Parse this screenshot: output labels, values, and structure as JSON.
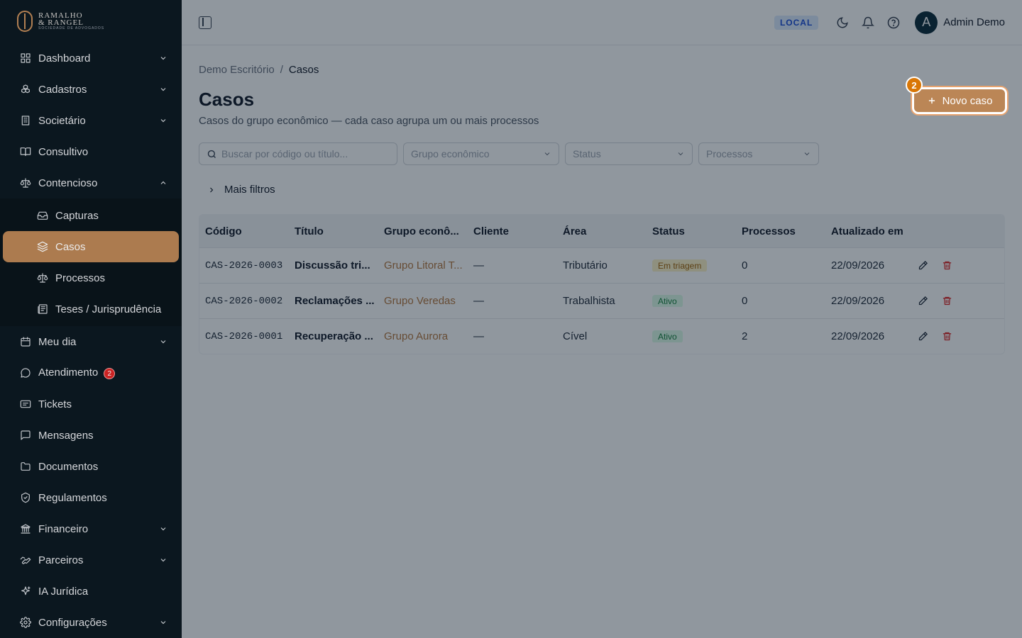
{
  "brand": {
    "line1": "RAMALHO",
    "line2": "& RANGEL",
    "tagline": "SOCIEDADE DE ADVOGADOS"
  },
  "sidebar": {
    "items": [
      {
        "label": "Dashboard",
        "icon": "grid-icon",
        "expandable": true
      },
      {
        "label": "Cadastros",
        "icon": "boxes-icon",
        "expandable": true
      },
      {
        "label": "Societário",
        "icon": "building-icon",
        "expandable": true
      },
      {
        "label": "Consultivo",
        "icon": "book-icon",
        "expandable": false
      },
      {
        "label": "Contencioso",
        "icon": "scale-icon",
        "expandable": true,
        "expanded": true
      }
    ],
    "subitems": [
      {
        "label": "Capturas",
        "icon": "inbox-icon"
      },
      {
        "label": "Casos",
        "icon": "layers-icon",
        "active": true
      },
      {
        "label": "Processos",
        "icon": "scale-icon"
      },
      {
        "label": "Teses / Jurisprudência",
        "icon": "newspaper-icon"
      }
    ],
    "items_after": [
      {
        "label": "Meu dia",
        "icon": "calendar-icon",
        "expandable": true
      },
      {
        "label": "Atendimento",
        "icon": "chat-icon",
        "badge": "2"
      },
      {
        "label": "Tickets",
        "icon": "ticket-icon"
      },
      {
        "label": "Mensagens",
        "icon": "message-icon"
      },
      {
        "label": "Documentos",
        "icon": "folder-icon"
      },
      {
        "label": "Regulamentos",
        "icon": "shield-icon"
      },
      {
        "label": "Financeiro",
        "icon": "landmark-icon",
        "expandable": true
      },
      {
        "label": "Parceiros",
        "icon": "handshake-icon",
        "expandable": true
      },
      {
        "label": "IA Jurídica",
        "icon": "sparkles-icon"
      },
      {
        "label": "Configurações",
        "icon": "gear-icon",
        "expandable": true
      }
    ]
  },
  "header": {
    "env": "LOCAL",
    "avatar_initial": "A",
    "user_name": "Admin Demo"
  },
  "page": {
    "breadcrumb_root": "Demo Escritório",
    "breadcrumb_sep": "/",
    "breadcrumb_current": "Casos",
    "title": "Casos",
    "subtitle": "Casos do grupo econômico — cada caso agrupa um ou mais processos",
    "new_button": "Novo caso",
    "step": "2"
  },
  "filters": {
    "search_placeholder": "Buscar por código ou título...",
    "grupo_placeholder": "Grupo econômico",
    "status_placeholder": "Status",
    "processos_placeholder": "Processos",
    "more_filters": "Mais filtros"
  },
  "table": {
    "headers": [
      "Código",
      "Título",
      "Grupo econô...",
      "Cliente",
      "Área",
      "Status",
      "Processos",
      "Atualizado em"
    ],
    "rows": [
      {
        "codigo": "CAS-2026-0003",
        "titulo": "Discussão tri...",
        "grupo": "Grupo Litoral T...",
        "cliente": "—",
        "area": "Tributário",
        "status": "Em triagem",
        "processos": "0",
        "atualizado": "22/09/2026"
      },
      {
        "codigo": "CAS-2026-0002",
        "titulo": "Reclamações ...",
        "grupo": "Grupo Veredas",
        "cliente": "—",
        "area": "Trabalhista",
        "status": "Ativo",
        "processos": "0",
        "atualizado": "22/09/2026"
      },
      {
        "codigo": "CAS-2026-0001",
        "titulo": "Recuperação ...",
        "grupo": "Grupo Aurora",
        "cliente": "—",
        "area": "Cível",
        "status": "Ativo",
        "processos": "2",
        "atualizado": "22/09/2026"
      }
    ]
  },
  "colors": {
    "accent": "#bb8656",
    "sidebar_bg": "#0c1a22",
    "triagem_bg": "#fef3c7",
    "triagem_fg": "#a16207",
    "ativo_bg": "#dcfce7",
    "ativo_fg": "#15803d",
    "delete": "#dc2626"
  }
}
